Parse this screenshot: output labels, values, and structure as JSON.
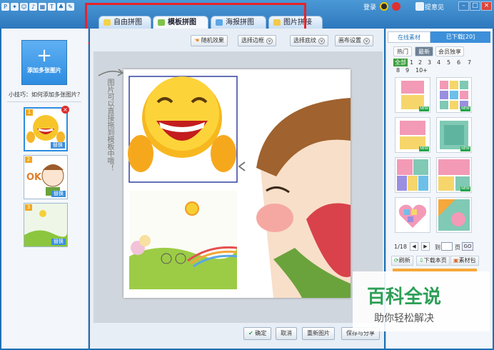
{
  "header": {
    "login": "登录",
    "feedback": "提意见",
    "window_buttons": [
      "–",
      "□",
      "×"
    ]
  },
  "tabs": [
    {
      "label": "自由拼图"
    },
    {
      "label": "模板拼图"
    },
    {
      "label": "海报拼图"
    },
    {
      "label": "图片拼接"
    }
  ],
  "toolbar": {
    "random": "随机效果",
    "border": "选择边框",
    "texture": "选择底纹",
    "canvas": "画布设置"
  },
  "left": {
    "add_label": "添加多张图片",
    "tip": "小技巧：如何添加多张图片？",
    "thumbs": [
      {
        "num": "1",
        "replace": "替换"
      },
      {
        "num": "2",
        "replace": "替换"
      },
      {
        "num": "3",
        "replace": "替换"
      }
    ]
  },
  "canvas": {
    "hint": "图片可以直接拖到模板中哦！"
  },
  "bottom": {
    "ok": "确定",
    "cancel": "取消",
    "reset": "重新图片",
    "save": "保存与分享"
  },
  "right": {
    "tab_online": "在线素材",
    "tab_downloaded": "已下载[20]",
    "filters": [
      "热门",
      "最新",
      "会员独享"
    ],
    "numbers": [
      "全部",
      "1",
      "2",
      "3",
      "4",
      "5",
      "6",
      "7",
      "8",
      "9",
      "10+"
    ],
    "new_badge": "NEW",
    "page": "1/18",
    "goto": "到",
    "page_unit": "页",
    "go": "GO",
    "refresh": "刷新",
    "download_page": "下载本页",
    "material_pack": "素材包"
  },
  "watermark": {
    "title": "百科全说",
    "subtitle": "助你轻松解决"
  },
  "colors": {
    "accent": "#2d8de0",
    "highlight": "#e8232a",
    "watermark_green": "#2d9f57"
  }
}
